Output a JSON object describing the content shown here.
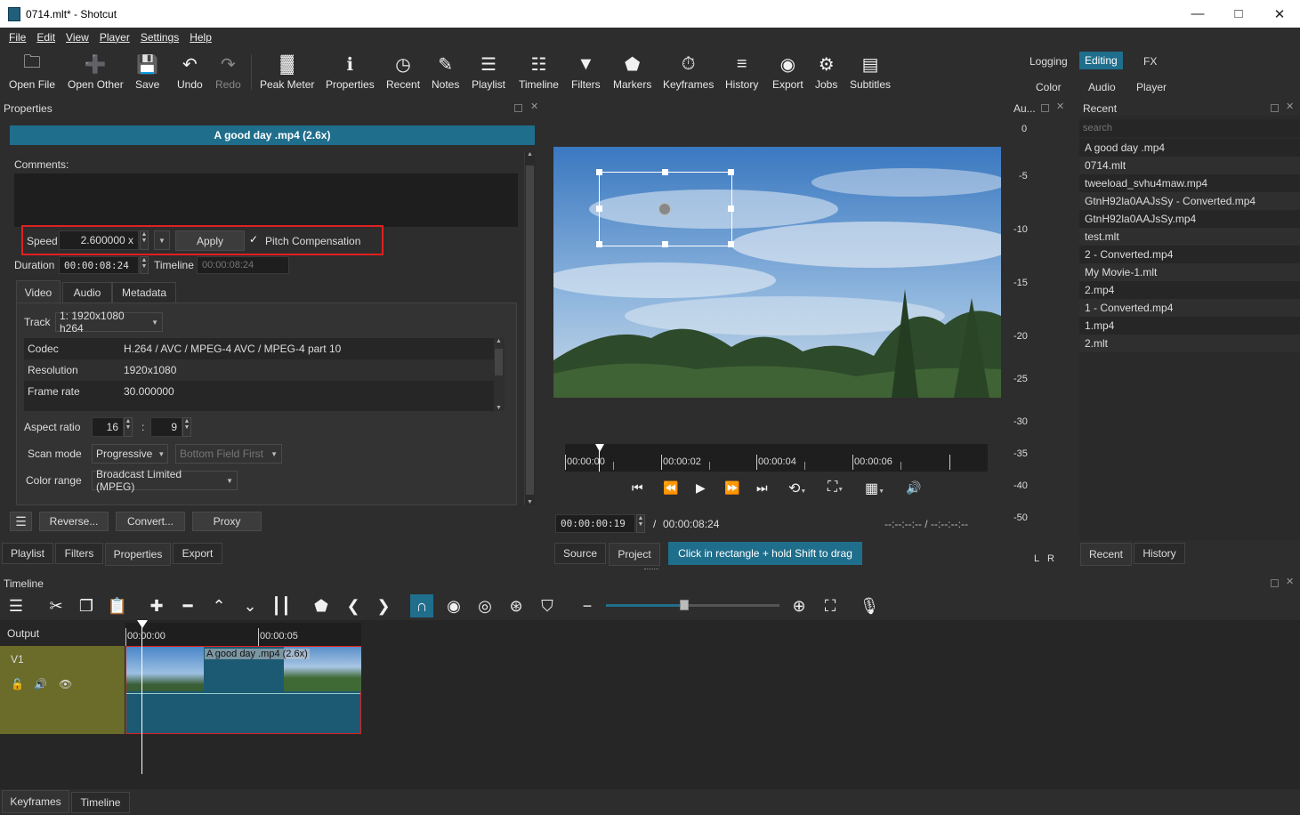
{
  "window": {
    "title": "0714.mlt* - Shotcut"
  },
  "menu": [
    "File",
    "Edit",
    "View",
    "Player",
    "Settings",
    "Help"
  ],
  "toolbar": [
    {
      "label": "Open File",
      "icon": "open-file-icon"
    },
    {
      "label": "Open Other",
      "icon": "open-other-icon"
    },
    {
      "label": "Save",
      "icon": "save-icon"
    },
    {
      "label": "Undo",
      "icon": "undo-icon"
    },
    {
      "label": "Redo",
      "icon": "redo-icon"
    },
    {
      "label": "Peak Meter",
      "icon": "peak-meter-icon"
    },
    {
      "label": "Properties",
      "icon": "properties-icon"
    },
    {
      "label": "Recent",
      "icon": "recent-icon"
    },
    {
      "label": "Notes",
      "icon": "notes-icon"
    },
    {
      "label": "Playlist",
      "icon": "playlist-icon"
    },
    {
      "label": "Timeline",
      "icon": "timeline-icon"
    },
    {
      "label": "Filters",
      "icon": "filters-icon"
    },
    {
      "label": "Markers",
      "icon": "markers-icon"
    },
    {
      "label": "Keyframes",
      "icon": "keyframes-icon"
    },
    {
      "label": "History",
      "icon": "history-icon"
    },
    {
      "label": "Export",
      "icon": "export-icon"
    },
    {
      "label": "Jobs",
      "icon": "jobs-icon"
    },
    {
      "label": "Subtitles",
      "icon": "subtitles-icon"
    }
  ],
  "layouts": {
    "logging": "Logging",
    "editing": "Editing",
    "fx": "FX",
    "color": "Color",
    "audio": "Audio",
    "player": "Player"
  },
  "properties": {
    "panel_title": "Properties",
    "clip_name": "A good day .mp4 (2.6x)",
    "comments_label": "Comments:",
    "speed_label": "Speed",
    "speed_value": "2.600000 x",
    "apply": "Apply",
    "pitch_compensation": "Pitch Compensation",
    "duration_label": "Duration",
    "duration_value": "00:00:08:24",
    "timeline_label": "Timeline",
    "timeline_value": "00:00:08:24",
    "tabs": [
      "Video",
      "Audio",
      "Metadata"
    ],
    "track_label": "Track",
    "track_value": "1: 1920x1080 h264",
    "info": [
      {
        "k": "Codec",
        "v": "H.264 / AVC / MPEG-4 AVC / MPEG-4 part 10"
      },
      {
        "k": "Resolution",
        "v": "1920x1080"
      },
      {
        "k": "Frame rate",
        "v": "30.000000"
      }
    ],
    "aspect_label": "Aspect ratio",
    "aspect_w": "16",
    "aspect_h": "9",
    "aspect_sep": ":",
    "scan_label": "Scan mode",
    "scan_value": "Progressive",
    "field_value": "Bottom Field First",
    "color_label": "Color range",
    "color_value": "Broadcast Limited (MPEG)",
    "reverse": "Reverse...",
    "convert": "Convert...",
    "proxy": "Proxy"
  },
  "left_tabs": [
    "Playlist",
    "Filters",
    "Properties",
    "Export"
  ],
  "player": {
    "ruler": [
      "00:00:00",
      "00:00:02",
      "00:00:04",
      "00:00:06"
    ],
    "position": "00:00:00:19",
    "slash": "/",
    "total": "00:00:08:24",
    "in_out": "--:--:--:-- / --:--:--:--",
    "tabs": [
      "Source",
      "Project"
    ],
    "hint": "Click in rectangle + hold Shift to drag"
  },
  "audio_meter": {
    "title": "Au...",
    "ticks": [
      "0",
      "-5",
      "-10",
      "-15",
      "-20",
      "-25",
      "-30",
      "-35",
      "-40",
      "-50"
    ],
    "l": "L",
    "r": "R"
  },
  "recent": {
    "title": "Recent",
    "search_placeholder": "search",
    "items": [
      "A good day .mp4",
      "0714.mlt",
      "tweeload_svhu4maw.mp4",
      "GtnH92la0AAJsSy - Converted.mp4",
      "GtnH92la0AAJsSy.mp4",
      "test.mlt",
      "2 - Converted.mp4",
      "My Movie-1.mlt",
      "2.mp4",
      "1 - Converted.mp4",
      "1.mp4",
      "2.mlt"
    ],
    "tabs": [
      "Recent",
      "History"
    ]
  },
  "timeline": {
    "title": "Timeline",
    "output_label": "Output",
    "ruler": [
      "00:00:00",
      "00:00:05"
    ],
    "track_name": "V1",
    "clip_label": "A good day .mp4 (2.6x)",
    "zoom_level": 0.45
  },
  "bottom_tabs": [
    "Keyframes",
    "Timeline"
  ],
  "colors": {
    "accent": "#1f6e8c",
    "highlight_box": "#e02020",
    "track_header": "#6b6b2a",
    "clip": "#1c5a73"
  }
}
